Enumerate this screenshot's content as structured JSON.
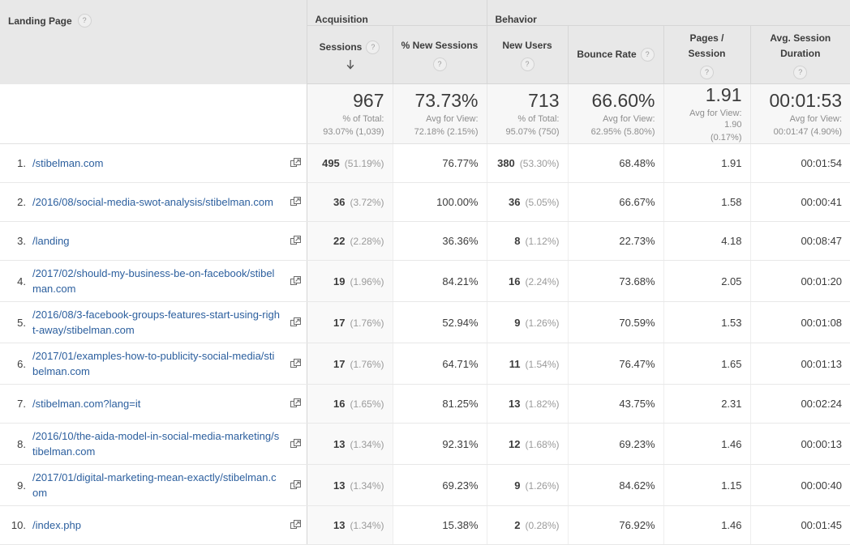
{
  "table": {
    "group_headers": [
      {
        "label": "",
        "name": "group-header-blank"
      },
      {
        "label": "Acquisition",
        "name": "group-header-acquisition"
      },
      {
        "label": "Behavior",
        "name": "group-header-behavior"
      }
    ],
    "dimension_header": {
      "label": "Landing Page",
      "help_icon": "help-icon"
    },
    "metric_headers": [
      {
        "label": "Sessions",
        "help_icon": "help-icon",
        "sorted": true,
        "sort_direction": "desc"
      },
      {
        "label": "% New Sessions",
        "help_icon": "help-icon",
        "sorted": false
      },
      {
        "label": "New Users",
        "help_icon": "help-icon",
        "sorted": false
      },
      {
        "label": "Bounce Rate",
        "help_icon": "help-icon",
        "sorted": false
      },
      {
        "label": "Pages / Session",
        "help_icon": "help-icon",
        "sorted": false
      },
      {
        "label": "Avg. Session Duration",
        "help_icon": "help-icon",
        "sorted": false
      }
    ],
    "summary": {
      "sessions": {
        "value": "967",
        "sub_line1": "% of Total:",
        "sub_line2": "93.07% (1,039)"
      },
      "pct_new_sessions": {
        "value": "73.73%",
        "sub_line1": "Avg for View:",
        "sub_line2": "72.18% (2.15%)"
      },
      "new_users": {
        "value": "713",
        "sub_line1": "% of Total:",
        "sub_line2": "95.07% (750)"
      },
      "bounce_rate": {
        "value": "66.60%",
        "sub_line1": "Avg for View:",
        "sub_line2": "62.95% (5.80%)"
      },
      "pages_per_session": {
        "value": "1.91",
        "sub_line1": "Avg for View: 1.90",
        "sub_line2": "(0.17%)"
      },
      "avg_session_duration": {
        "value": "00:01:53",
        "sub_line1": "Avg for View:",
        "sub_line2": "00:01:47 (4.90%)"
      }
    },
    "rows": [
      {
        "index": "1.",
        "landing_page": "/stibelman.com",
        "external_link_icon": "open-in-new-icon",
        "sessions": "495",
        "sessions_pct": "(51.19%)",
        "pct_new_sessions": "76.77%",
        "new_users": "380",
        "new_users_pct": "(53.30%)",
        "bounce_rate": "68.48%",
        "pages_per_session": "1.91",
        "avg_session_duration": "00:01:54"
      },
      {
        "index": "2.",
        "landing_page": "/2016/08/social-media-swot-analysis/stibelman.com",
        "external_link_icon": "open-in-new-icon",
        "sessions": "36",
        "sessions_pct": "(3.72%)",
        "pct_new_sessions": "100.00%",
        "new_users": "36",
        "new_users_pct": "(5.05%)",
        "bounce_rate": "66.67%",
        "pages_per_session": "1.58",
        "avg_session_duration": "00:00:41"
      },
      {
        "index": "3.",
        "landing_page": "/landing",
        "external_link_icon": "open-in-new-icon",
        "sessions": "22",
        "sessions_pct": "(2.28%)",
        "pct_new_sessions": "36.36%",
        "new_users": "8",
        "new_users_pct": "(1.12%)",
        "bounce_rate": "22.73%",
        "pages_per_session": "4.18",
        "avg_session_duration": "00:08:47"
      },
      {
        "index": "4.",
        "landing_page": "/2017/02/should-my-business-be-on-facebook/stibelman.com",
        "external_link_icon": "open-in-new-icon",
        "sessions": "19",
        "sessions_pct": "(1.96%)",
        "pct_new_sessions": "84.21%",
        "new_users": "16",
        "new_users_pct": "(2.24%)",
        "bounce_rate": "73.68%",
        "pages_per_session": "2.05",
        "avg_session_duration": "00:01:20"
      },
      {
        "index": "5.",
        "landing_page": "/2016/08/3-facebook-groups-features-start-using-right-away/stibelman.com",
        "external_link_icon": "open-in-new-icon",
        "sessions": "17",
        "sessions_pct": "(1.76%)",
        "pct_new_sessions": "52.94%",
        "new_users": "9",
        "new_users_pct": "(1.26%)",
        "bounce_rate": "70.59%",
        "pages_per_session": "1.53",
        "avg_session_duration": "00:01:08"
      },
      {
        "index": "6.",
        "landing_page": "/2017/01/examples-how-to-publicity-social-media/stibelman.com",
        "external_link_icon": "open-in-new-icon",
        "sessions": "17",
        "sessions_pct": "(1.76%)",
        "pct_new_sessions": "64.71%",
        "new_users": "11",
        "new_users_pct": "(1.54%)",
        "bounce_rate": "76.47%",
        "pages_per_session": "1.65",
        "avg_session_duration": "00:01:13"
      },
      {
        "index": "7.",
        "landing_page": "/stibelman.com?lang=it",
        "external_link_icon": "open-in-new-icon",
        "sessions": "16",
        "sessions_pct": "(1.65%)",
        "pct_new_sessions": "81.25%",
        "new_users": "13",
        "new_users_pct": "(1.82%)",
        "bounce_rate": "43.75%",
        "pages_per_session": "2.31",
        "avg_session_duration": "00:02:24"
      },
      {
        "index": "8.",
        "landing_page": "/2016/10/the-aida-model-in-social-media-marketing/stibelman.com",
        "external_link_icon": "open-in-new-icon",
        "sessions": "13",
        "sessions_pct": "(1.34%)",
        "pct_new_sessions": "92.31%",
        "new_users": "12",
        "new_users_pct": "(1.68%)",
        "bounce_rate": "69.23%",
        "pages_per_session": "1.46",
        "avg_session_duration": "00:00:13"
      },
      {
        "index": "9.",
        "landing_page": "/2017/01/digital-marketing-mean-exactly/stibelman.com",
        "external_link_icon": "open-in-new-icon",
        "sessions": "13",
        "sessions_pct": "(1.34%)",
        "pct_new_sessions": "69.23%",
        "new_users": "9",
        "new_users_pct": "(1.26%)",
        "bounce_rate": "84.62%",
        "pages_per_session": "1.15",
        "avg_session_duration": "00:00:40"
      },
      {
        "index": "10.",
        "landing_page": "/index.php",
        "external_link_icon": "open-in-new-icon",
        "sessions": "13",
        "sessions_pct": "(1.34%)",
        "pct_new_sessions": "15.38%",
        "new_users": "2",
        "new_users_pct": "(0.28%)",
        "bounce_rate": "76.92%",
        "pages_per_session": "1.46",
        "avg_session_duration": "00:01:45"
      }
    ]
  },
  "colors": {
    "link": "#2c5f9e",
    "header_bg": "#e8e8e8",
    "sorted_column_bg": "#f9f9f9",
    "text": "#3c3c3c",
    "muted_text": "#9a9a9a"
  }
}
